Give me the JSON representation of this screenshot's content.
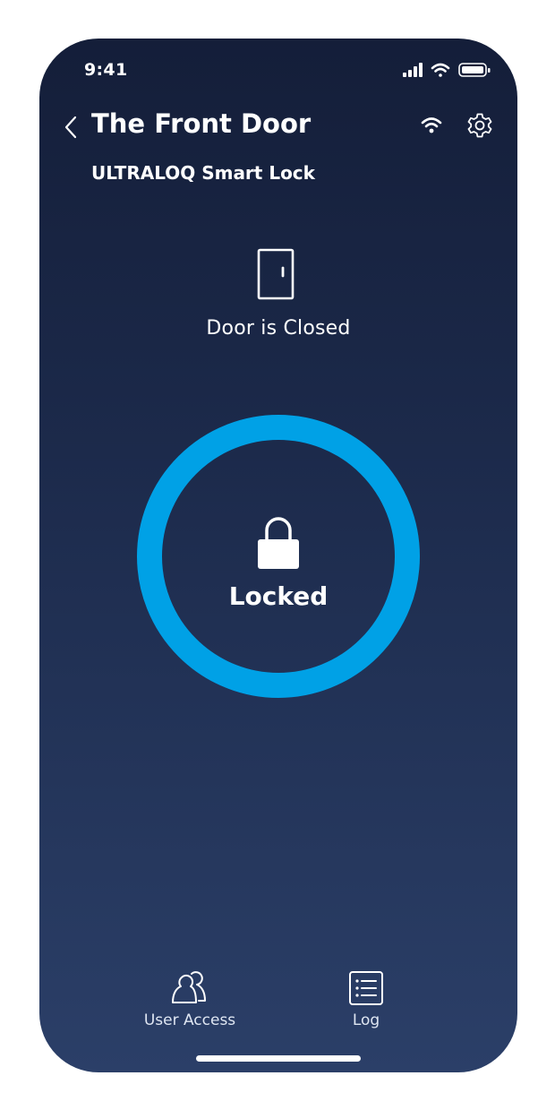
{
  "status_bar": {
    "time": "9:41",
    "icons": [
      "cellular-signal-icon",
      "wifi-icon",
      "battery-icon"
    ]
  },
  "header": {
    "title": "The Front Door",
    "subtitle": "ULTRALOQ Smart Lock",
    "icons": [
      "chevron-left-icon",
      "wifi-icon",
      "gear-icon"
    ]
  },
  "door": {
    "icon": "door-icon",
    "status": "Door is Closed"
  },
  "lock": {
    "icon": "padlock-icon",
    "label": "Locked",
    "accent_color": "#00a1e6"
  },
  "bottom_nav": {
    "user_access_label": "User Access",
    "log_label": "Log",
    "icons": [
      "users-icon",
      "list-icon"
    ]
  },
  "colors": {
    "background_top": "#141e39",
    "background_bottom": "#2b3f68",
    "text": "#ffffff"
  }
}
